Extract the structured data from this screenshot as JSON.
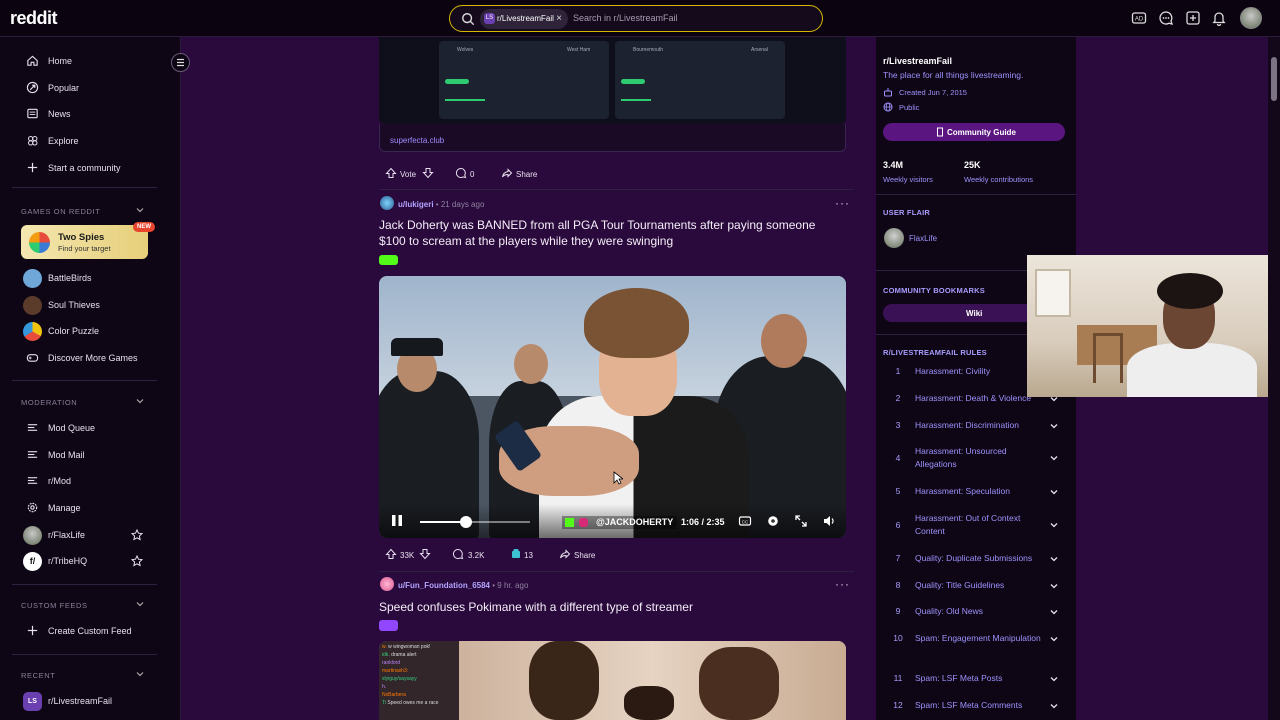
{
  "header": {
    "logo": "reddit",
    "search_chip": "r/LivestreamFail",
    "search_chip_avatar": "LS",
    "search_placeholder": "Search in r/LivestreamFail",
    "icons": [
      "ad-icon",
      "chat-icon",
      "create-icon",
      "notification-icon",
      "avatar"
    ]
  },
  "sidebar": {
    "main_nav": [
      {
        "label": "Home",
        "icon": "home-icon"
      },
      {
        "label": "Popular",
        "icon": "popular-icon"
      },
      {
        "label": "News",
        "icon": "news-icon"
      },
      {
        "label": "Explore",
        "icon": "explore-icon"
      },
      {
        "label": "Start a community",
        "icon": "plus-icon"
      }
    ],
    "games_header": "GAMES ON REDDIT",
    "featured_game": {
      "title": "Two Spies",
      "subtitle": "Find your target",
      "badge": "NEW"
    },
    "games": [
      "BattleBirds",
      "Soul Thieves",
      "Color Puzzle"
    ],
    "discover_games": "Discover More Games",
    "moderation_header": "MODERATION",
    "moderation": [
      "Mod Queue",
      "Mod Mail",
      "r/Mod",
      "Manage"
    ],
    "mod_communities": [
      "r/FlaxLife",
      "r/TribeHQ"
    ],
    "custom_feeds_header": "CUSTOM FEEDS",
    "create_feed": "Create Custom Feed",
    "recent_header": "RECENT",
    "recent": [
      {
        "label": "r/LivestreamFail",
        "avatar": "LS"
      }
    ]
  },
  "feed": {
    "prev_post": {
      "link_domain": "superfecta.club",
      "vote_label": "Vote",
      "comments": "0",
      "share": "Share",
      "preview": {
        "left": {
          "home": "Wolves",
          "away": "West Ham"
        },
        "right": {
          "home": "Bournemouth",
          "away": "Arsenal"
        }
      }
    },
    "post1": {
      "user": "u/lukigeri",
      "age": "21 days ago",
      "title": "Jack Doherty was BANNED from all PGA Tour Tournaments after paying someone $100 to scream at the players while they were swinging",
      "flair": "kick",
      "video": {
        "time": "1:06 / 2:35",
        "watermark": "@JACKDOHERTY",
        "progress": 0.42
      },
      "votes": "33K",
      "comments": "3.2K",
      "awards": "13",
      "share": "Share"
    },
    "post2": {
      "user": "u/Fun_Foundation_6584",
      "age": "9 hr. ago",
      "title": "Speed confuses Pokimane with a different type of streamer",
      "flair": "twitch",
      "chat_lines": [
        {
          "user": "w.",
          "text": "w wingwoman pok!",
          "cls": "u1"
        },
        {
          "user": "idk.",
          "text": "drama alert",
          "cls": "u2"
        },
        {
          "user": "ranklord",
          "text": "",
          "cls": "u3"
        },
        {
          "user": "martinash3:",
          "text": "",
          "cls": "u1"
        },
        {
          "user": "slyiguy/saysayy",
          "text": "",
          "cls": "u2"
        },
        {
          "user": "h.",
          "text": "",
          "cls": "u3"
        },
        {
          "user": "NxBarbera",
          "text": "",
          "cls": "u1"
        },
        {
          "user": "Ti",
          "text": "Speed owes me a race",
          "cls": "u2"
        }
      ]
    }
  },
  "right_sidebar": {
    "community": "r/LivestreamFail",
    "description": "The place for all things livestreaming.",
    "created": "Created Jun 7, 2015",
    "visibility": "Public",
    "guide_button": "Community Guide",
    "stats": [
      {
        "value": "3.4M",
        "label": "Weekly visitors"
      },
      {
        "value": "25K",
        "label": "Weekly contributions"
      }
    ],
    "user_flair_header": "USER FLAIR",
    "user_flair": "FlaxLife",
    "bookmarks_header": "COMMUNITY BOOKMARKS",
    "wiki_button": "Wiki",
    "rules_header": "R/LIVESTREAMFAIL RULES",
    "rules": [
      {
        "n": "1",
        "text": "Harassment: Civility"
      },
      {
        "n": "2",
        "text": "Harassment: Death & Violence"
      },
      {
        "n": "3",
        "text": "Harassment: Discrimination"
      },
      {
        "n": "4",
        "text": "Harassment: Unsourced Allegations"
      },
      {
        "n": "5",
        "text": "Harassment: Speculation"
      },
      {
        "n": "6",
        "text": "Harassment: Out of Context Content"
      },
      {
        "n": "7",
        "text": "Quality: Duplicate Submissions"
      },
      {
        "n": "8",
        "text": "Quality: Title Guidelines"
      },
      {
        "n": "9",
        "text": "Quality: Old News"
      },
      {
        "n": "10",
        "text": "Spam: Engagement Manipulation"
      },
      {
        "n": "11",
        "text": "Spam: LSF Meta Posts"
      },
      {
        "n": "12",
        "text": "Spam: LSF Meta Comments"
      }
    ]
  },
  "colors": {
    "accent": "#5a1580",
    "link": "#9f93ff",
    "search_border": "#d6b800"
  }
}
